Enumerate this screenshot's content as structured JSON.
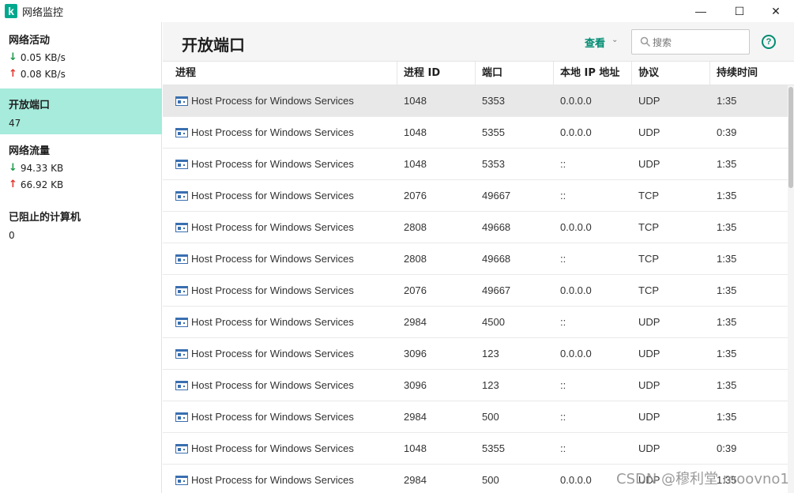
{
  "window": {
    "title": "网络监控",
    "logo_letter": "k",
    "minimize_glyph": "—",
    "maximize_glyph": "☐",
    "close_glyph": "✕"
  },
  "sidebar": {
    "items": [
      {
        "title": "网络活动",
        "down": "0.05 KB/s",
        "up": "0.08 KB/s",
        "active": false
      },
      {
        "title": "开放端口",
        "value": "47",
        "active": true
      },
      {
        "title": "网络流量",
        "down": "94.33 KB",
        "up": "66.92 KB",
        "active": false
      },
      {
        "title": "已阻止的计算机",
        "value": "0",
        "active": false
      }
    ],
    "down_arrow": "↓",
    "up_arrow": "↑"
  },
  "header": {
    "title": "开放端口",
    "view_label": "查看",
    "view_chevron": "⌄",
    "search_placeholder": "搜索",
    "help_glyph": "?"
  },
  "table": {
    "columns": [
      "进程",
      "进程 ID",
      "端口",
      "本地 IP 地址",
      "协议",
      "持续时间"
    ],
    "rows": [
      {
        "process": "Host Process for Windows Services",
        "pid": "1048",
        "port": "5353",
        "ip": "0.0.0.0",
        "protocol": "UDP",
        "duration": "1:35"
      },
      {
        "process": "Host Process for Windows Services",
        "pid": "1048",
        "port": "5355",
        "ip": "0.0.0.0",
        "protocol": "UDP",
        "duration": "0:39"
      },
      {
        "process": "Host Process for Windows Services",
        "pid": "1048",
        "port": "5353",
        "ip": "::",
        "protocol": "UDP",
        "duration": "1:35"
      },
      {
        "process": "Host Process for Windows Services",
        "pid": "2076",
        "port": "49667",
        "ip": "::",
        "protocol": "TCP",
        "duration": "1:35"
      },
      {
        "process": "Host Process for Windows Services",
        "pid": "2808",
        "port": "49668",
        "ip": "0.0.0.0",
        "protocol": "TCP",
        "duration": "1:35"
      },
      {
        "process": "Host Process for Windows Services",
        "pid": "2808",
        "port": "49668",
        "ip": "::",
        "protocol": "TCP",
        "duration": "1:35"
      },
      {
        "process": "Host Process for Windows Services",
        "pid": "2076",
        "port": "49667",
        "ip": "0.0.0.0",
        "protocol": "TCP",
        "duration": "1:35"
      },
      {
        "process": "Host Process for Windows Services",
        "pid": "2984",
        "port": "4500",
        "ip": "::",
        "protocol": "UDP",
        "duration": "1:35"
      },
      {
        "process": "Host Process for Windows Services",
        "pid": "3096",
        "port": "123",
        "ip": "0.0.0.0",
        "protocol": "UDP",
        "duration": "1:35"
      },
      {
        "process": "Host Process for Windows Services",
        "pid": "3096",
        "port": "123",
        "ip": "::",
        "protocol": "UDP",
        "duration": "1:35"
      },
      {
        "process": "Host Process for Windows Services",
        "pid": "2984",
        "port": "500",
        "ip": "::",
        "protocol": "UDP",
        "duration": "1:35"
      },
      {
        "process": "Host Process for Windows Services",
        "pid": "1048",
        "port": "5355",
        "ip": "::",
        "protocol": "UDP",
        "duration": "0:39"
      },
      {
        "process": "Host Process for Windows Services",
        "pid": "2984",
        "port": "500",
        "ip": "0.0.0.0",
        "protocol": "UDP",
        "duration": "1:35"
      }
    ],
    "selected_row": 0
  },
  "watermark": "CSDN @穆利堂 moovno1",
  "colors": {
    "accent": "#008c72",
    "active_sidebar": "#a6ebdc",
    "down_arrow": "#1a9a4a",
    "up_arrow": "#e0352b"
  }
}
